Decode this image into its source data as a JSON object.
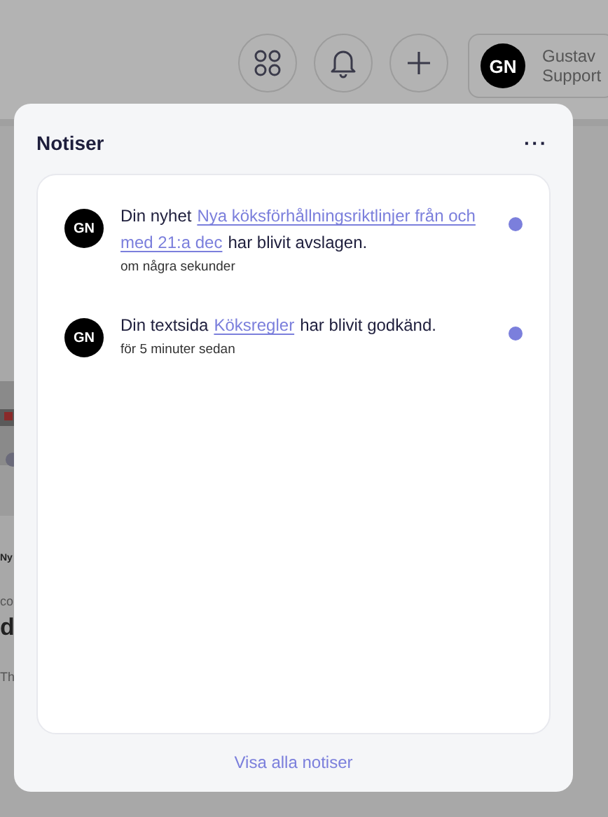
{
  "header": {
    "user": {
      "initials": "GN",
      "name": "Gustav",
      "role": "Support"
    }
  },
  "background_fragments": [
    {
      "kind": "small",
      "text": "Ny"
    },
    {
      "kind": "muted",
      "text": "co"
    },
    {
      "kind": "big",
      "text": "d"
    },
    {
      "kind": "muted",
      "text": "Th"
    }
  ],
  "notifications_panel": {
    "title": "Notiser",
    "menu": "···",
    "items": [
      {
        "initials": "GN",
        "parts": [
          {
            "text": "Din nyhet",
            "link": false
          },
          {
            "text": "Nya köksförhållningsriktlinjer från och",
            "link": true
          },
          {
            "text": "med 21:a dec",
            "link": true
          },
          {
            "text": "har blivit avslagen.",
            "link": false
          }
        ],
        "time": "om några sekunder",
        "unread": true
      },
      {
        "initials": "GN",
        "parts": [
          {
            "text": "Din textsida",
            "link": false
          },
          {
            "text": "Köksregler",
            "link": true
          },
          {
            "text": "har blivit godkänd.",
            "link": false
          }
        ],
        "time": "för 5 minuter sedan",
        "unread": true
      }
    ],
    "footer_link": "Visa alla notiser"
  }
}
